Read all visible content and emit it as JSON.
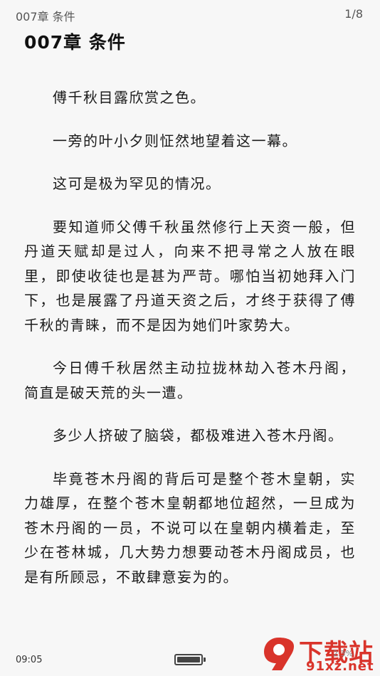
{
  "header": {
    "chapter_short": "007章 条件",
    "page_indicator": "1/8"
  },
  "chapter_title": "007章 条件",
  "paragraphs": [
    "傅千秋目露欣赏之色。",
    "一旁的叶小夕则怔然地望着这一幕。",
    "这可是极为罕见的情况。",
    "要知道师父傅千秋虽然修行上天资一般，但丹道天赋却是过人，向来不把寻常之人放在眼里，即使收徒也是甚为严苛。哪怕当初她拜入门下，也是展露了丹道天资之后，才终于获得了傅千秋的青睐，而不是因为她们叶家势大。",
    "今日傅千秋居然主动拉拢林劫入苍木丹阁，简直是破天荒的头一遭。",
    "多少人挤破了脑袋，都极难进入苍木丹阁。",
    "毕竟苍木丹阁的背后可是整个苍木皇朝，实力雄厚，在整个苍木皇朝都地位超然，一旦成为苍木丹阁的一员，不说可以在皇朝内横着走，至少在苍林城，几大势力想要动苍木丹阁成员，也是有所顾忌，不敢肆意妄为的。"
  ],
  "footer": {
    "time": "09:05",
    "battery_level": 1.0,
    "progress_text": "2.3%"
  },
  "watermark": {
    "brand": "下载站",
    "url": "91xz.net",
    "logo_glyph": "9"
  },
  "colors": {
    "background": "#f7f7f7",
    "text": "#1a1a1a",
    "watermark_red": "#d9342b"
  }
}
